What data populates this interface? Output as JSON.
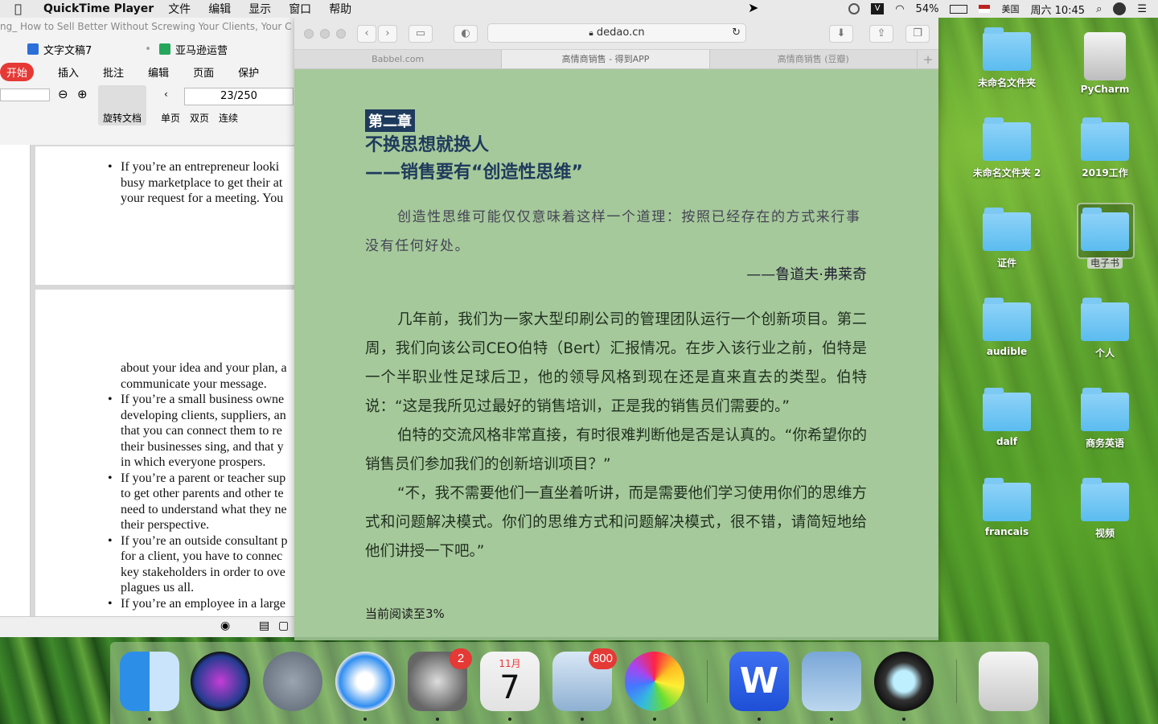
{
  "menubar": {
    "app_name": "QuickTime Player",
    "menus": [
      "文件",
      "编辑",
      "显示",
      "窗口",
      "帮助"
    ],
    "battery": "54%",
    "input_method": "美国",
    "clock": "周六 10:45"
  },
  "wps": {
    "doc_title": "ng_ How to Sell Better Without Screwing Your Clients, Your C",
    "tabs": [
      {
        "label": "文字文稿7"
      },
      {
        "label": "亚马逊运营"
      }
    ],
    "ribbon": [
      "开始",
      "插入",
      "批注",
      "编辑",
      "页面",
      "保护"
    ],
    "page_indicator": "23/250",
    "rotate_label": "旋转文档",
    "view_single": "单页",
    "view_double": "双页",
    "view_continuous": "连续",
    "page1_lines": [
      "If you’re an entrepreneur looki",
      "busy marketplace to get their at",
      "your request for a meeting. You"
    ],
    "page2_lines": [
      {
        "text": "about your idea and your plan, a",
        "bullet": false
      },
      {
        "text": "communicate your message.",
        "bullet": false
      },
      {
        "text": "If you’re a small business owne",
        "bullet": true
      },
      {
        "text": "developing clients, suppliers, an",
        "bullet": false
      },
      {
        "text": "that you can connect them to re",
        "bullet": false
      },
      {
        "text": "their businesses sing, and that y",
        "bullet": false
      },
      {
        "text": "in which everyone prospers.",
        "bullet": false
      },
      {
        "text": "If you’re a parent or teacher sup",
        "bullet": true
      },
      {
        "text": "to get other parents and other te",
        "bullet": false
      },
      {
        "text": "need to understand what they ne",
        "bullet": false
      },
      {
        "text": "their perspective.",
        "bullet": false
      },
      {
        "text": "If you’re an outside consultant p",
        "bullet": true
      },
      {
        "text": "for a client, you have to connec",
        "bullet": false
      },
      {
        "text": "key stakeholders in order to ove",
        "bullet": false
      },
      {
        "text": "plagues us all.",
        "bullet": false
      },
      {
        "text": "If you’re an employee in a large",
        "bullet": true
      }
    ]
  },
  "safari": {
    "url": "dedao.cn",
    "tabs": [
      {
        "label": "Babbel.com",
        "active": false
      },
      {
        "label": "高情商销售 - 得到APP",
        "active": true
      },
      {
        "label": "高情商销售 (豆瓣)",
        "active": false
      }
    ],
    "reader": {
      "chapter_tag": "第二章",
      "title_line1": "不换思想就换人",
      "title_line2": "——销售要有“创造性思维”",
      "quote": "创造性思维可能仅仅意味着这样一个道理：按照已经存在的方式来行事没有任何好处。",
      "quote_author": "——鲁道夫·弗莱奇",
      "paragraphs": [
        "几年前，我们为一家大型印刷公司的管理团队运行一个创新项目。第二周，我们向该公司CEO伯特（Bert）汇报情况。在步入该行业之前，伯特是一个半职业性足球后卫，他的领导风格到现在还是直来直去的类型。伯特说：“这是我所见过最好的销售培训，正是我的销售员们需要的。”",
        "伯特的交流风格非常直接，有时很难判断他是否是认真的。“你希望你的销售员们参加我们的创新培训项目？”",
        "“不，我不需要他们一直坐着听讲，而是需要他们学习使用你们的思维方式和问题解决模式。你们的思维方式和问题解决模式，很不错，请简短地给他们讲授一下吧。”"
      ],
      "progress": "当前阅读至3%"
    }
  },
  "desktop_icons": [
    {
      "label": "未命名文件夹",
      "type": "folder"
    },
    {
      "label": "PyCharm",
      "type": "drive"
    },
    {
      "label": "未命名文件夹 2",
      "type": "folder"
    },
    {
      "label": "2019工作",
      "type": "folder"
    },
    {
      "label": "证件",
      "type": "folder"
    },
    {
      "label": "电子书",
      "type": "folder"
    },
    {
      "label": "audible",
      "type": "folder"
    },
    {
      "label": "个人",
      "type": "folder"
    },
    {
      "label": "dalf",
      "type": "folder"
    },
    {
      "label": "商务英语",
      "type": "folder"
    },
    {
      "label": "francais",
      "type": "folder"
    },
    {
      "label": "视频",
      "type": "folder"
    }
  ],
  "dock": {
    "items": [
      {
        "name": "finder-icon",
        "badge": ""
      },
      {
        "name": "siri-icon",
        "badge": ""
      },
      {
        "name": "launchpad-icon",
        "badge": ""
      },
      {
        "name": "safari-icon",
        "badge": ""
      },
      {
        "name": "system-preferences-icon",
        "badge": "2"
      },
      {
        "name": "calendar-icon",
        "badge": ""
      },
      {
        "name": "mail-icon",
        "badge": "800"
      },
      {
        "name": "photos-icon",
        "badge": ""
      },
      {
        "name": "wps-icon",
        "badge": ""
      },
      {
        "name": "preview-icon",
        "badge": ""
      },
      {
        "name": "quicktime-icon",
        "badge": ""
      },
      {
        "name": "trash-icon",
        "badge": ""
      }
    ],
    "calendar_month": "11月",
    "calendar_day": "7"
  }
}
